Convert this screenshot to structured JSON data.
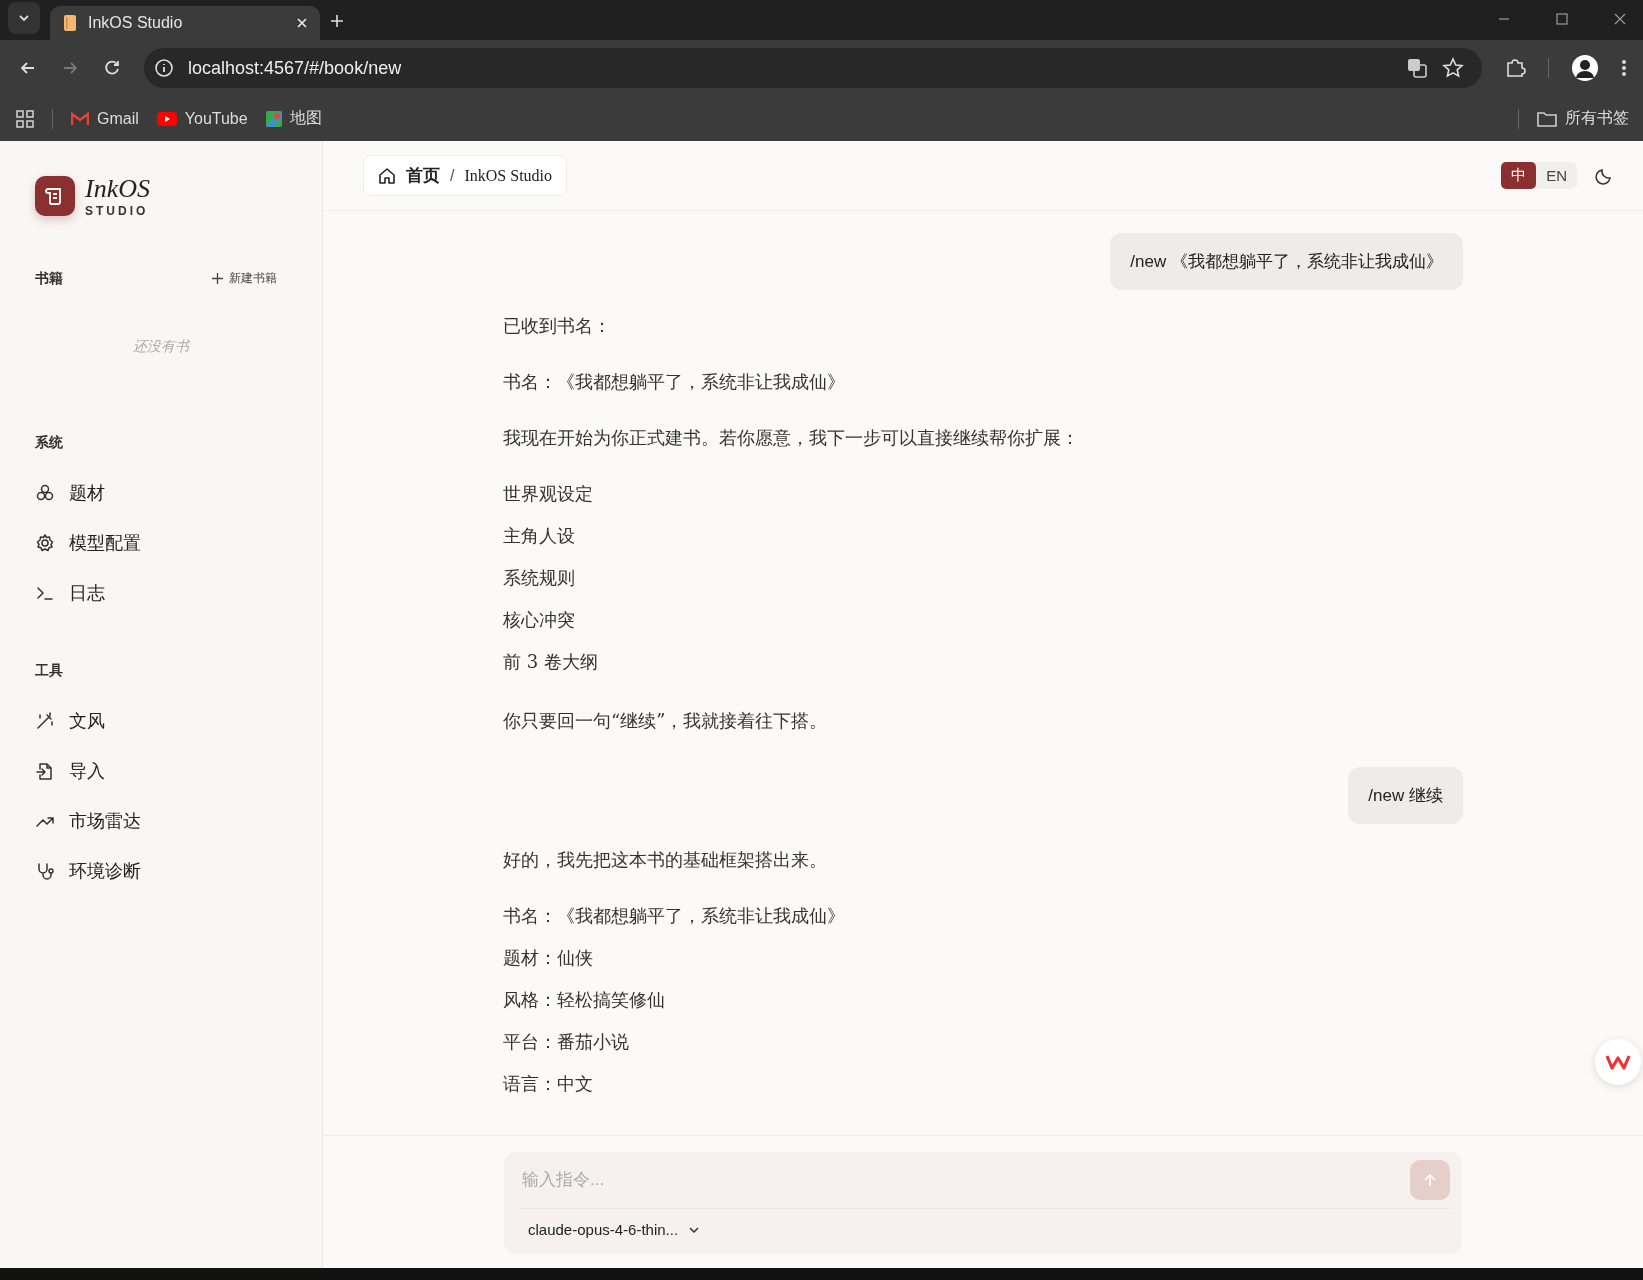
{
  "browser": {
    "tab_title": "InkOS Studio",
    "url": "localhost:4567/#/book/new",
    "bookmarks": [
      "Gmail",
      "YouTube",
      "地图"
    ],
    "all_bookmarks": "所有书签"
  },
  "sidebar": {
    "brand": {
      "name": "InkOS",
      "sub": "STUDIO"
    },
    "books": {
      "title": "书籍",
      "action": "新建书籍",
      "empty": "还没有书"
    },
    "sections": [
      {
        "title": "系统",
        "items": [
          "题材",
          "模型配置",
          "日志"
        ]
      },
      {
        "title": "工具",
        "items": [
          "文风",
          "导入",
          "市场雷达",
          "环境诊断"
        ]
      }
    ]
  },
  "header": {
    "breadcrumb": {
      "home": "首页",
      "separator": "/",
      "current": "InkOS Studio"
    },
    "languages": [
      {
        "label": "中",
        "selected": true
      },
      {
        "label": "EN",
        "selected": false
      }
    ]
  },
  "messages": [
    {
      "kind": "user",
      "text": "/new 《我都想躺平了，系统非让我成仙》"
    },
    {
      "kind": "assistant",
      "blocks": [
        {
          "kind": "para",
          "text": "已收到书名："
        },
        {
          "kind": "para",
          "text": "书名：《我都想躺平了，系统非让我成仙》"
        },
        {
          "kind": "para",
          "text": "我现在开始为你正式建书。若你愿意，我下一步可以直接继续帮你扩展："
        },
        {
          "kind": "lines",
          "lines": [
            "世界观设定",
            "主角人设",
            "系统规则",
            "核心冲突",
            "前 3 卷大纲"
          ]
        },
        {
          "kind": "para",
          "text": "你只要回一句“继续”，我就接着往下搭。"
        }
      ]
    },
    {
      "kind": "user",
      "text": "/new 继续"
    },
    {
      "kind": "assistant",
      "blocks": [
        {
          "kind": "para",
          "text": "好的，我先把这本书的基础框架搭出来。"
        },
        {
          "kind": "lines",
          "lines": [
            "书名：《我都想躺平了，系统非让我成仙》",
            "题材：仙侠",
            "风格：轻松搞笑修仙",
            "平台：番茄小说",
            "语言：中文"
          ]
        }
      ]
    }
  ],
  "composer": {
    "placeholder": "输入指令...",
    "model": "claude-opus-4-6-thin..."
  }
}
